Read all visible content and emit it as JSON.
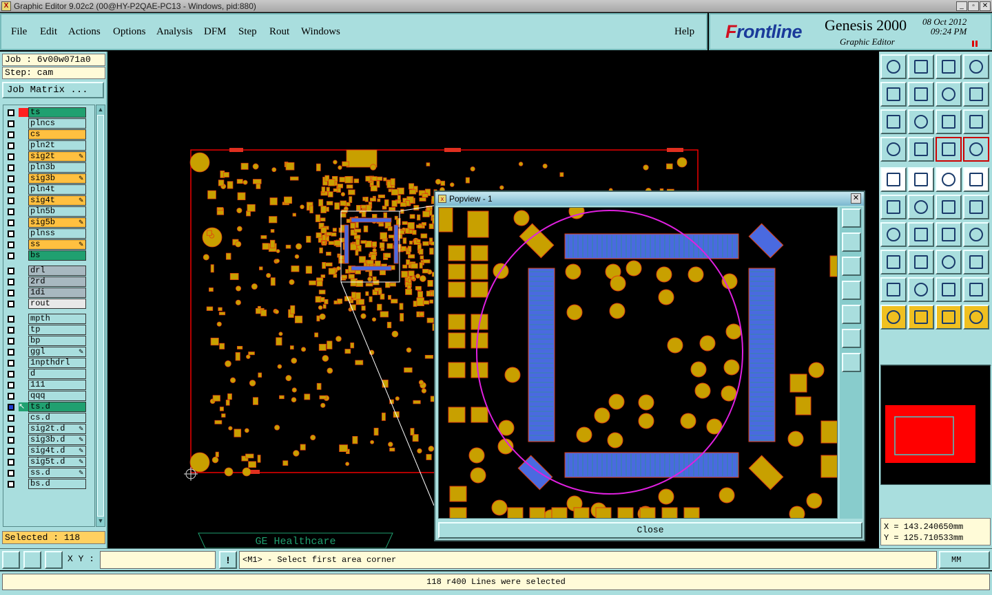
{
  "window": {
    "title": "Graphic Editor 9.02c2 (00@HY-P2QAE-PC13 - Windows, pid:880)",
    "icon": "x-icon"
  },
  "menu": [
    "File",
    "Edit",
    "Actions",
    "Options",
    "Analysis",
    "DFM",
    "Step",
    "Rout",
    "Windows"
  ],
  "help": "Help",
  "brand": {
    "logo_prefix": "F",
    "logo": "rontline",
    "product": "Genesis 2000",
    "subtitle": "Graphic Editor",
    "date": "08 Oct 2012",
    "time": "09:24 PM"
  },
  "job": "Job : 6v00w071a0",
  "step": "Step: cam",
  "job_matrix": "Job Matrix ...",
  "layers": [
    {
      "name": "ts",
      "color": "#20a070",
      "swatch": "#ff2020",
      "pen": false
    },
    {
      "name": "plncs",
      "color": "#a9dede",
      "pen": false
    },
    {
      "name": "cs",
      "color": "#ffc040",
      "pen": false
    },
    {
      "name": "pln2t",
      "color": "#a9dede",
      "pen": false
    },
    {
      "name": "sig2t",
      "color": "#ffc040",
      "pen": true
    },
    {
      "name": "pln3b",
      "color": "#a9dede",
      "pen": false
    },
    {
      "name": "sig3b",
      "color": "#ffc040",
      "pen": true
    },
    {
      "name": "pln4t",
      "color": "#a9dede",
      "pen": false
    },
    {
      "name": "sig4t",
      "color": "#ffc040",
      "pen": true
    },
    {
      "name": "pln5b",
      "color": "#a9dede",
      "pen": false
    },
    {
      "name": "sig5b",
      "color": "#ffc040",
      "pen": true
    },
    {
      "name": "plnss",
      "color": "#a9dede",
      "pen": false
    },
    {
      "name": "ss",
      "color": "#ffc040",
      "pen": true
    },
    {
      "name": "bs",
      "color": "#20a070",
      "pen": false
    },
    {
      "name": "drl",
      "color": "#a8b8c0",
      "pen": false
    },
    {
      "name": "2rd",
      "color": "#a8b8c0",
      "pen": false
    },
    {
      "name": "1di",
      "color": "#a8b8c0",
      "pen": false
    },
    {
      "name": "rout",
      "color": "#e8e8e8",
      "pen": false
    },
    {
      "name": "mpth",
      "color": "#a9dede",
      "pen": false
    },
    {
      "name": "tp",
      "color": "#a9dede",
      "pen": false
    },
    {
      "name": "bp",
      "color": "#a9dede",
      "pen": false
    },
    {
      "name": "ggl",
      "color": "#a9dede",
      "pen": true
    },
    {
      "name": "1npthdrl",
      "color": "#a9dede",
      "pen": false
    },
    {
      "name": "d",
      "color": "#a9dede",
      "pen": false
    },
    {
      "name": "111",
      "color": "#a9dede",
      "pen": false
    },
    {
      "name": "qqq",
      "color": "#a9dede",
      "pen": false
    },
    {
      "name": "ts.d",
      "color": "#20a070",
      "pen": false,
      "active": true
    },
    {
      "name": "cs.d",
      "color": "#a9dede",
      "pen": false
    },
    {
      "name": "sig2t.d",
      "color": "#a9dede",
      "pen": true
    },
    {
      "name": "sig3b.d",
      "color": "#a9dede",
      "pen": true
    },
    {
      "name": "sig4t.d",
      "color": "#a9dede",
      "pen": true
    },
    {
      "name": "sig5t.d",
      "color": "#a9dede",
      "pen": true
    },
    {
      "name": "ss.d",
      "color": "#a9dede",
      "pen": true
    },
    {
      "name": "bs.d",
      "color": "#a9dede",
      "pen": false
    }
  ],
  "selected": "Selected : 118",
  "coords": {
    "x": "X = 143.240650mm",
    "y": "Y = 125.710533mm"
  },
  "xy_label": "X Y :",
  "xy_value": "",
  "prompt": "<M1> - Select first area corner",
  "units": "MM",
  "status": "118 r400 Lines were selected",
  "popview": {
    "title": "Popview - 1",
    "close": "Close"
  },
  "board_label": "GE Healthcare",
  "colors": {
    "panel": "#a9dede",
    "pad": "#c8a000",
    "selected": "#4a6ae0",
    "outline": "#e00000",
    "circle": "#e020e0"
  }
}
